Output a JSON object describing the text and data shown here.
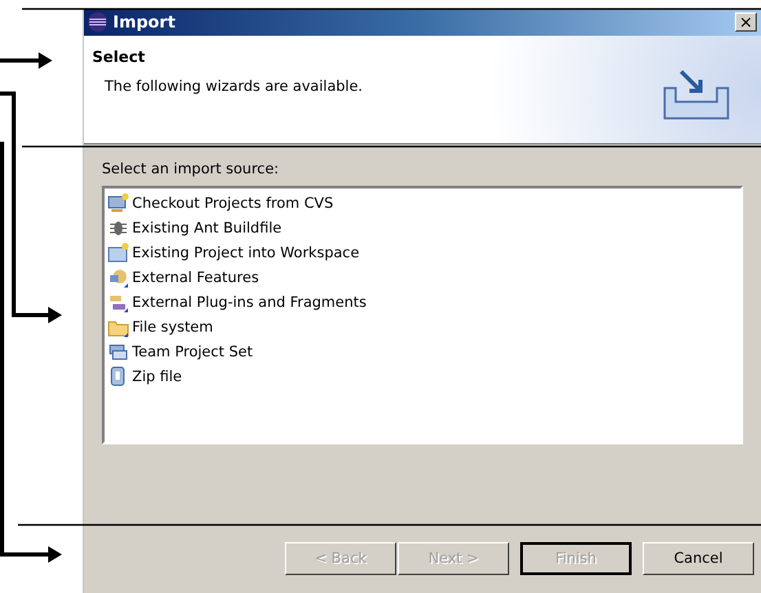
{
  "window": {
    "title": "Import",
    "close": "×"
  },
  "header": {
    "title": "Select",
    "description": "The following wizards are available."
  },
  "source_list": {
    "label": "Select an import source:",
    "items": [
      {
        "label": "Checkout Projects from CVS"
      },
      {
        "label": "Existing Ant Buildfile"
      },
      {
        "label": "Existing Project into Workspace"
      },
      {
        "label": "External Features"
      },
      {
        "label": "External Plug-ins and Fragments"
      },
      {
        "label": "File system"
      },
      {
        "label": "Team Project Set"
      },
      {
        "label": "Zip file"
      }
    ]
  },
  "buttons": [
    {
      "label": "< Back",
      "disabled": true,
      "default": false
    },
    {
      "label": "Next >",
      "disabled": true,
      "default": false
    },
    {
      "label": "Finish",
      "disabled": true,
      "default": true
    },
    {
      "label": "Cancel",
      "disabled": false,
      "default": false
    }
  ]
}
